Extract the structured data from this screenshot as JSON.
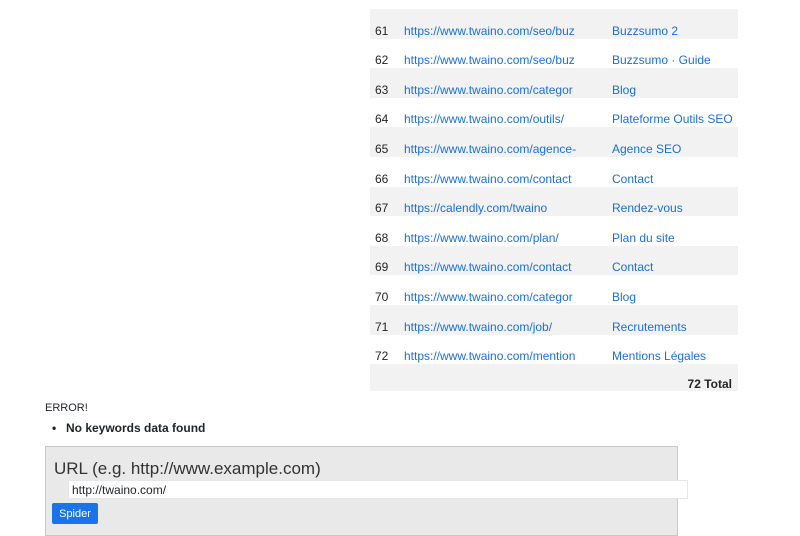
{
  "links_table": {
    "rows": [
      {
        "num": "61",
        "url": "https://www.twaino.com/seo/buz",
        "anchor": "Buzzsumo 2"
      },
      {
        "num": "62",
        "url": "https://www.twaino.com/seo/buz",
        "anchor": "Buzzsumo   ·   Guide"
      },
      {
        "num": "63",
        "url": "https://www.twaino.com/categor",
        "anchor": "Blog"
      },
      {
        "num": "64",
        "url": "https://www.twaino.com/outils/",
        "anchor": "Plateforme Outils SEO"
      },
      {
        "num": "65",
        "url": "https://www.twaino.com/agence-",
        "anchor": "Agence SEO"
      },
      {
        "num": "66",
        "url": "https://www.twaino.com/contact",
        "anchor": "Contact"
      },
      {
        "num": "67",
        "url": "https://calendly.com/twaino",
        "anchor": "Rendez-vous"
      },
      {
        "num": "68",
        "url": "https://www.twaino.com/plan/",
        "anchor": "Plan du site"
      },
      {
        "num": "69",
        "url": "https://www.twaino.com/contact",
        "anchor": "Contact"
      },
      {
        "num": "70",
        "url": "https://www.twaino.com/categor",
        "anchor": "Blog"
      },
      {
        "num": "71",
        "url": "https://www.twaino.com/job/",
        "anchor": "Recrutements"
      },
      {
        "num": "72",
        "url": "https://www.twaino.com/mention",
        "anchor": "Mentions Légales"
      }
    ],
    "total": "72 Total"
  },
  "error": {
    "title": "ERROR!",
    "messages": [
      "No keywords data found"
    ]
  },
  "form": {
    "label": "URL (e.g. http://www.example.com)",
    "url_value": "http://twaino.com/",
    "button_label": "Spider"
  },
  "colors": {
    "link": "#1a6fd9",
    "stripe": "#f2f2f2",
    "button": "#1a73e8",
    "form_background": "#e9e9e9"
  }
}
